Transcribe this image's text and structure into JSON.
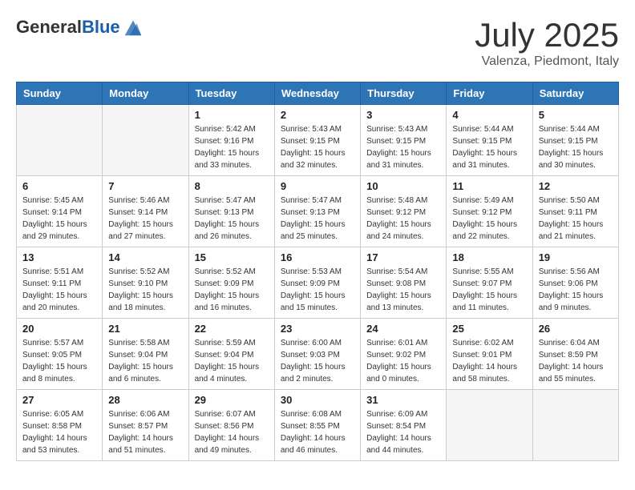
{
  "header": {
    "logo_general": "General",
    "logo_blue": "Blue",
    "month_title": "July 2025",
    "location": "Valenza, Piedmont, Italy"
  },
  "weekdays": [
    "Sunday",
    "Monday",
    "Tuesday",
    "Wednesday",
    "Thursday",
    "Friday",
    "Saturday"
  ],
  "weeks": [
    [
      {
        "day": "",
        "empty": true
      },
      {
        "day": "",
        "empty": true
      },
      {
        "day": "1",
        "sunrise": "Sunrise: 5:42 AM",
        "sunset": "Sunset: 9:16 PM",
        "daylight": "Daylight: 15 hours and 33 minutes."
      },
      {
        "day": "2",
        "sunrise": "Sunrise: 5:43 AM",
        "sunset": "Sunset: 9:15 PM",
        "daylight": "Daylight: 15 hours and 32 minutes."
      },
      {
        "day": "3",
        "sunrise": "Sunrise: 5:43 AM",
        "sunset": "Sunset: 9:15 PM",
        "daylight": "Daylight: 15 hours and 31 minutes."
      },
      {
        "day": "4",
        "sunrise": "Sunrise: 5:44 AM",
        "sunset": "Sunset: 9:15 PM",
        "daylight": "Daylight: 15 hours and 31 minutes."
      },
      {
        "day": "5",
        "sunrise": "Sunrise: 5:44 AM",
        "sunset": "Sunset: 9:15 PM",
        "daylight": "Daylight: 15 hours and 30 minutes."
      }
    ],
    [
      {
        "day": "6",
        "sunrise": "Sunrise: 5:45 AM",
        "sunset": "Sunset: 9:14 PM",
        "daylight": "Daylight: 15 hours and 29 minutes."
      },
      {
        "day": "7",
        "sunrise": "Sunrise: 5:46 AM",
        "sunset": "Sunset: 9:14 PM",
        "daylight": "Daylight: 15 hours and 27 minutes."
      },
      {
        "day": "8",
        "sunrise": "Sunrise: 5:47 AM",
        "sunset": "Sunset: 9:13 PM",
        "daylight": "Daylight: 15 hours and 26 minutes."
      },
      {
        "day": "9",
        "sunrise": "Sunrise: 5:47 AM",
        "sunset": "Sunset: 9:13 PM",
        "daylight": "Daylight: 15 hours and 25 minutes."
      },
      {
        "day": "10",
        "sunrise": "Sunrise: 5:48 AM",
        "sunset": "Sunset: 9:12 PM",
        "daylight": "Daylight: 15 hours and 24 minutes."
      },
      {
        "day": "11",
        "sunrise": "Sunrise: 5:49 AM",
        "sunset": "Sunset: 9:12 PM",
        "daylight": "Daylight: 15 hours and 22 minutes."
      },
      {
        "day": "12",
        "sunrise": "Sunrise: 5:50 AM",
        "sunset": "Sunset: 9:11 PM",
        "daylight": "Daylight: 15 hours and 21 minutes."
      }
    ],
    [
      {
        "day": "13",
        "sunrise": "Sunrise: 5:51 AM",
        "sunset": "Sunset: 9:11 PM",
        "daylight": "Daylight: 15 hours and 20 minutes."
      },
      {
        "day": "14",
        "sunrise": "Sunrise: 5:52 AM",
        "sunset": "Sunset: 9:10 PM",
        "daylight": "Daylight: 15 hours and 18 minutes."
      },
      {
        "day": "15",
        "sunrise": "Sunrise: 5:52 AM",
        "sunset": "Sunset: 9:09 PM",
        "daylight": "Daylight: 15 hours and 16 minutes."
      },
      {
        "day": "16",
        "sunrise": "Sunrise: 5:53 AM",
        "sunset": "Sunset: 9:09 PM",
        "daylight": "Daylight: 15 hours and 15 minutes."
      },
      {
        "day": "17",
        "sunrise": "Sunrise: 5:54 AM",
        "sunset": "Sunset: 9:08 PM",
        "daylight": "Daylight: 15 hours and 13 minutes."
      },
      {
        "day": "18",
        "sunrise": "Sunrise: 5:55 AM",
        "sunset": "Sunset: 9:07 PM",
        "daylight": "Daylight: 15 hours and 11 minutes."
      },
      {
        "day": "19",
        "sunrise": "Sunrise: 5:56 AM",
        "sunset": "Sunset: 9:06 PM",
        "daylight": "Daylight: 15 hours and 9 minutes."
      }
    ],
    [
      {
        "day": "20",
        "sunrise": "Sunrise: 5:57 AM",
        "sunset": "Sunset: 9:05 PM",
        "daylight": "Daylight: 15 hours and 8 minutes."
      },
      {
        "day": "21",
        "sunrise": "Sunrise: 5:58 AM",
        "sunset": "Sunset: 9:04 PM",
        "daylight": "Daylight: 15 hours and 6 minutes."
      },
      {
        "day": "22",
        "sunrise": "Sunrise: 5:59 AM",
        "sunset": "Sunset: 9:04 PM",
        "daylight": "Daylight: 15 hours and 4 minutes."
      },
      {
        "day": "23",
        "sunrise": "Sunrise: 6:00 AM",
        "sunset": "Sunset: 9:03 PM",
        "daylight": "Daylight: 15 hours and 2 minutes."
      },
      {
        "day": "24",
        "sunrise": "Sunrise: 6:01 AM",
        "sunset": "Sunset: 9:02 PM",
        "daylight": "Daylight: 15 hours and 0 minutes."
      },
      {
        "day": "25",
        "sunrise": "Sunrise: 6:02 AM",
        "sunset": "Sunset: 9:01 PM",
        "daylight": "Daylight: 14 hours and 58 minutes."
      },
      {
        "day": "26",
        "sunrise": "Sunrise: 6:04 AM",
        "sunset": "Sunset: 8:59 PM",
        "daylight": "Daylight: 14 hours and 55 minutes."
      }
    ],
    [
      {
        "day": "27",
        "sunrise": "Sunrise: 6:05 AM",
        "sunset": "Sunset: 8:58 PM",
        "daylight": "Daylight: 14 hours and 53 minutes."
      },
      {
        "day": "28",
        "sunrise": "Sunrise: 6:06 AM",
        "sunset": "Sunset: 8:57 PM",
        "daylight": "Daylight: 14 hours and 51 minutes."
      },
      {
        "day": "29",
        "sunrise": "Sunrise: 6:07 AM",
        "sunset": "Sunset: 8:56 PM",
        "daylight": "Daylight: 14 hours and 49 minutes."
      },
      {
        "day": "30",
        "sunrise": "Sunrise: 6:08 AM",
        "sunset": "Sunset: 8:55 PM",
        "daylight": "Daylight: 14 hours and 46 minutes."
      },
      {
        "day": "31",
        "sunrise": "Sunrise: 6:09 AM",
        "sunset": "Sunset: 8:54 PM",
        "daylight": "Daylight: 14 hours and 44 minutes."
      },
      {
        "day": "",
        "empty": true
      },
      {
        "day": "",
        "empty": true
      }
    ]
  ]
}
